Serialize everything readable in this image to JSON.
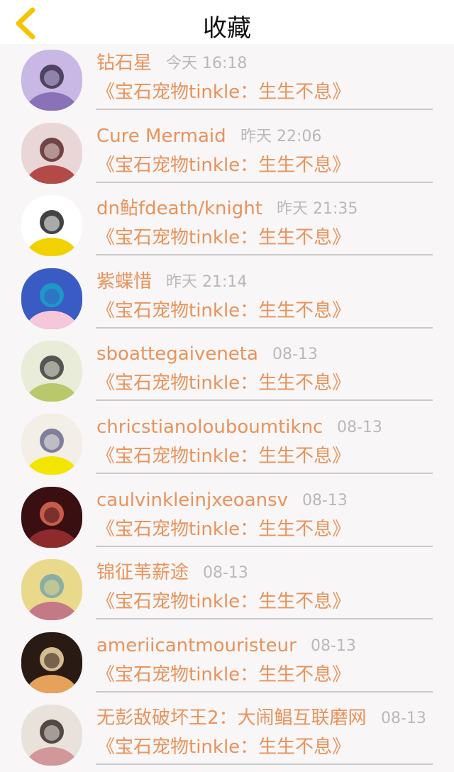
{
  "header": {
    "title": "收藏",
    "back_icon": "chevron-left-icon",
    "accent": "#f5c400"
  },
  "items": [
    {
      "name": "钻石星",
      "time": "今天 16:18",
      "subtitle": "《宝石宠物tinkle：生生不息》",
      "avatar_palette": [
        "#c9b7e6",
        "#8a72b8",
        "#3a2f4a"
      ]
    },
    {
      "name": "Cure Mermaid",
      "time": "昨天 22:06",
      "subtitle": "《宝石宠物tinkle：生生不息》",
      "avatar_palette": [
        "#e9d7d7",
        "#b34a48",
        "#5a2a2a"
      ]
    },
    {
      "name": "dn鲇fdeath/knight",
      "time": "昨天 21:35",
      "subtitle": "《宝石宠物tinkle：生生不息》",
      "avatar_palette": [
        "#ffffff",
        "#f2d100",
        "#222222"
      ]
    },
    {
      "name": "紫蝶惜",
      "time": "昨天 21:14",
      "subtitle": "《宝石宠物tinkle：生生不息》",
      "avatar_palette": [
        "#3b5bc4",
        "#f6c7da",
        "#1aa3c7"
      ]
    },
    {
      "name": "sboattegaiveneta",
      "time": "08-13",
      "subtitle": "《宝石宠物tinkle：生生不息》",
      "avatar_palette": [
        "#e8ecd9",
        "#b9c86a",
        "#3b3b3b"
      ]
    },
    {
      "name": "chricstianolouboumtiknc",
      "time": "08-13",
      "subtitle": "《宝石宠物tinkle：生生不息》",
      "avatar_palette": [
        "#f3eee6",
        "#f2e600",
        "#6b6a8e"
      ]
    },
    {
      "name": "caulvinkleinjxeoansv",
      "time": "08-13",
      "subtitle": "《宝石宠物tinkle：生生不息》",
      "avatar_palette": [
        "#3a0f12",
        "#8c2a2c",
        "#e26a55"
      ]
    },
    {
      "name": "锦征苇薪途",
      "time": "08-13",
      "subtitle": "《宝石宠物tinkle：生生不息》",
      "avatar_palette": [
        "#e9d98a",
        "#c47a86",
        "#7aa4a8"
      ]
    },
    {
      "name": "ameriicantmouristeur",
      "time": "08-13",
      "subtitle": "《宝石宠物tinkle：生生不息》",
      "avatar_palette": [
        "#2a1a14",
        "#e6a25a",
        "#f3d9a8"
      ]
    },
    {
      "name": "无彭敌破坏王2：大闹鲳互联磨网",
      "time": "08-13",
      "subtitle": "《宝石宠物tinkle：生生不息》",
      "avatar_palette": [
        "#e9e2da",
        "#d1979a",
        "#3a2d2a"
      ]
    }
  ]
}
